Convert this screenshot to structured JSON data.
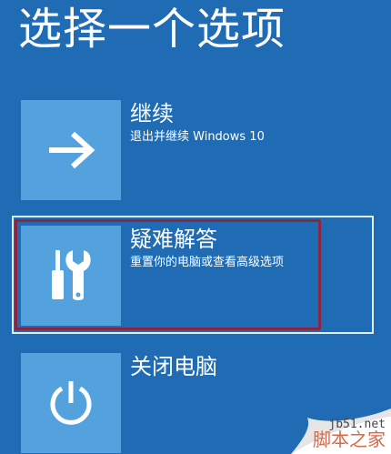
{
  "page": {
    "title": "选择一个选项"
  },
  "options": [
    {
      "label": "继续",
      "description": "退出并继续 Windows 10",
      "icon": "arrow-right-icon"
    },
    {
      "label": "疑难解答",
      "description": "重置你的电脑或查看高级选项",
      "icon": "tools-icon"
    },
    {
      "label": "关闭电脑",
      "description": "",
      "icon": "power-icon"
    }
  ],
  "watermark": {
    "site": "jb51.net",
    "name": "脚本之家"
  },
  "colors": {
    "background": "#1f6cb5",
    "tile": "#53a2de",
    "highlight": "#8a2642",
    "text": "#ffffff"
  }
}
